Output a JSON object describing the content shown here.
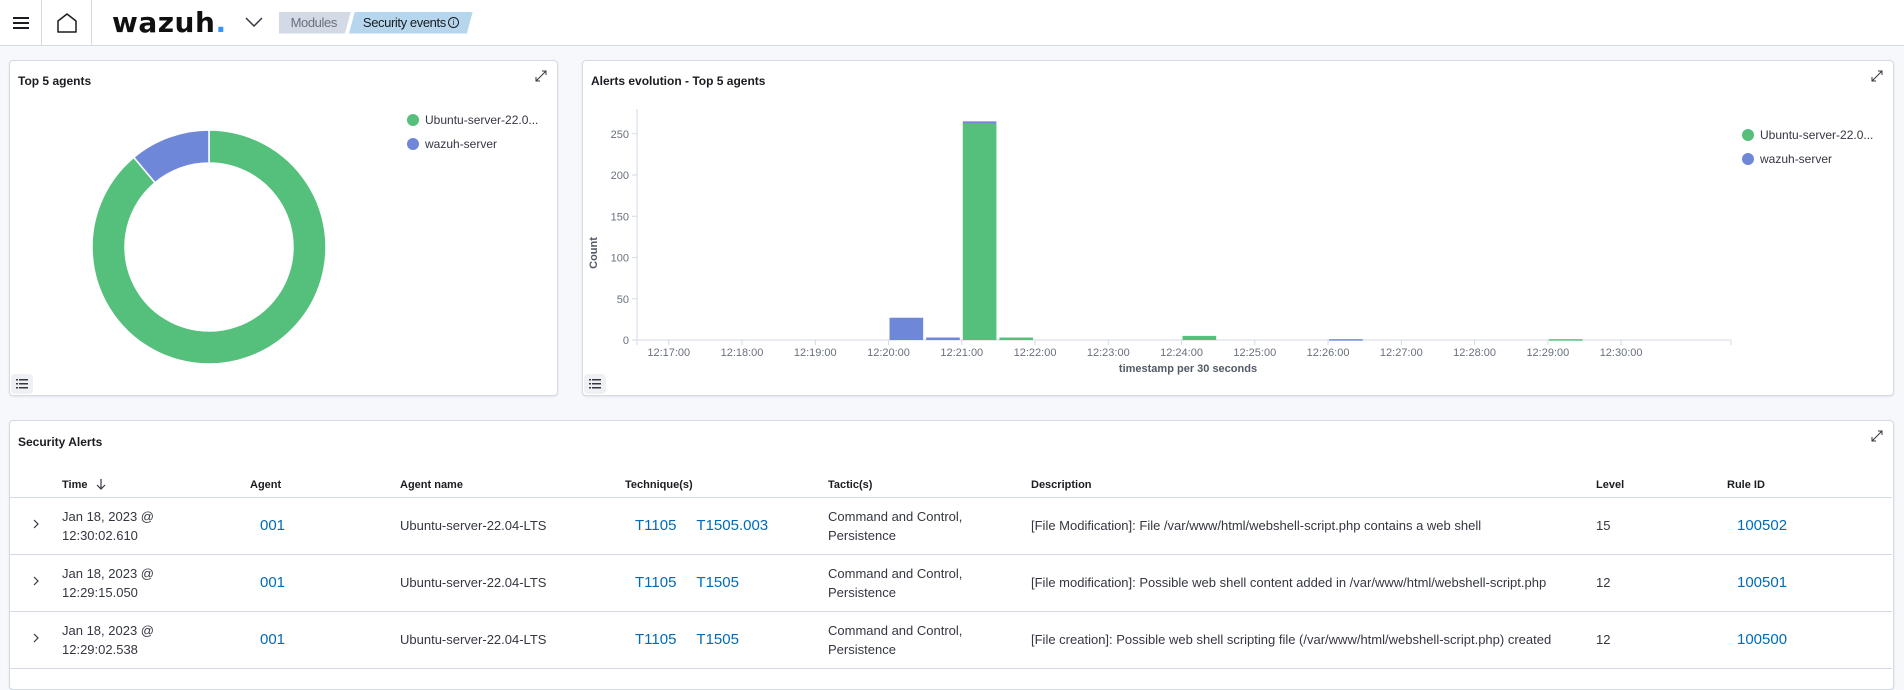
{
  "header": {
    "logo_text": "wazuh",
    "logo_dot": ".",
    "breadcrumbs": [
      "Modules",
      "Security events"
    ],
    "info_glyph": "i"
  },
  "icons": {
    "menu": "hamburger-menu-icon",
    "home": "home-icon",
    "logo_dropdown": "chevron-down-icon",
    "expand": "expand-icon",
    "legend_toggle": "list-icon",
    "sort": "arrow-down-icon",
    "row_expand": "chevron-right-icon"
  },
  "colors": {
    "green": "#54c07b",
    "blue": "#6e87d8",
    "link": "#006bb8",
    "breadcrumb_active": "#b5d6ec",
    "breadcrumb_inactive": "#d3dae6"
  },
  "top_agents": {
    "title": "Top 5 agents",
    "legend": [
      "Ubuntu-server-22.0...",
      "wazuh-server"
    ]
  },
  "alerts_evolution": {
    "title": "Alerts evolution - Top 5 agents",
    "legend": [
      "Ubuntu-server-22.0...",
      "wazuh-server"
    ]
  },
  "chart_data": [
    {
      "type": "pie",
      "title": "Top 5 agents",
      "donut": true,
      "labels": [
        "Ubuntu-server-22.04-LTS",
        "wazuh-server"
      ],
      "values": [
        272,
        34
      ],
      "colors": [
        "#54c07b",
        "#6e87d8"
      ],
      "legend": "top-right"
    },
    {
      "type": "bar",
      "stacked": true,
      "title": "Alerts evolution - Top 5 agents",
      "xlabel": "timestamp per 30 seconds",
      "ylabel": "Count",
      "ylim": [
        0,
        280
      ],
      "yticks": [
        0,
        50,
        100,
        150,
        200,
        250
      ],
      "xticks": [
        "12:17:00",
        "12:18:00",
        "12:19:00",
        "12:20:00",
        "12:21:00",
        "12:22:00",
        "12:23:00",
        "12:24:00",
        "12:25:00",
        "12:26:00",
        "12:27:00",
        "12:28:00",
        "12:29:00",
        "12:30:00"
      ],
      "x_range": [
        "12:16:34",
        "12:31:30"
      ],
      "x": [
        "12:20:00",
        "12:20:30",
        "12:21:00",
        "12:21:30",
        "12:24:00",
        "12:26:00",
        "12:29:00"
      ],
      "series": [
        {
          "name": "Ubuntu-server-22.0...",
          "color": "#54c07b",
          "values": [
            0,
            0,
            262,
            3,
            5,
            0,
            1
          ]
        },
        {
          "name": "wazuh-server",
          "color": "#6e87d8",
          "values": [
            27,
            3,
            3,
            0,
            0,
            1,
            0
          ]
        }
      ],
      "legend": "top-right",
      "grid": false
    }
  ],
  "security_alerts": {
    "title": "Security Alerts",
    "columns": [
      "Time",
      "Agent",
      "Agent name",
      "Technique(s)",
      "Tactic(s)",
      "Description",
      "Level",
      "Rule ID"
    ],
    "rows": [
      {
        "time_date": "Jan 18, 2023 @",
        "time_clock": "12:30:02.610",
        "agent": "001",
        "agent_name": "Ubuntu-server-22.04-LTS",
        "techniques": [
          "T1105",
          "T1505.003"
        ],
        "tactics_line1": "Command and Control,",
        "tactics_line2": "Persistence",
        "description": "[File Modification]: File /var/www/html/webshell-script.php contains a web shell",
        "level": "15",
        "rule_id": "100502"
      },
      {
        "time_date": "Jan 18, 2023 @",
        "time_clock": "12:29:15.050",
        "agent": "001",
        "agent_name": "Ubuntu-server-22.04-LTS",
        "techniques": [
          "T1105",
          "T1505"
        ],
        "tactics_line1": "Command and Control,",
        "tactics_line2": "Persistence",
        "description": "[File modification]: Possible web shell content added in /var/www/html/webshell-script.php",
        "level": "12",
        "rule_id": "100501"
      },
      {
        "time_date": "Jan 18, 2023 @",
        "time_clock": "12:29:02.538",
        "agent": "001",
        "agent_name": "Ubuntu-server-22.04-LTS",
        "techniques": [
          "T1105",
          "T1505"
        ],
        "tactics_line1": "Command and Control,",
        "tactics_line2": "Persistence",
        "description": "[File creation]: Possible web shell scripting file (/var/www/html/webshell-script.php) created",
        "level": "12",
        "rule_id": "100500"
      }
    ]
  }
}
